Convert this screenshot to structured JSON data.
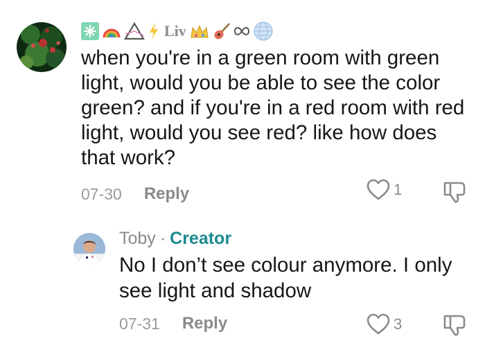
{
  "comment": {
    "username": "Liv",
    "text": "when you're in a green room with green light, would you be able to see the color green? and if you're in a red room with red light, would you see red? like how does that work?",
    "date": "07-30",
    "reply_label": "Reply",
    "likes": "1"
  },
  "reply": {
    "username": "Toby",
    "separator": "·",
    "creator_badge": "Creator",
    "text": "No I don’t see colour anymore. I only see light and shadow",
    "date": "07-31",
    "reply_label": "Reply",
    "likes": "3"
  },
  "colors": {
    "creator": "#1b8a8f",
    "muted": "#8a8a8a",
    "text": "#161616"
  }
}
